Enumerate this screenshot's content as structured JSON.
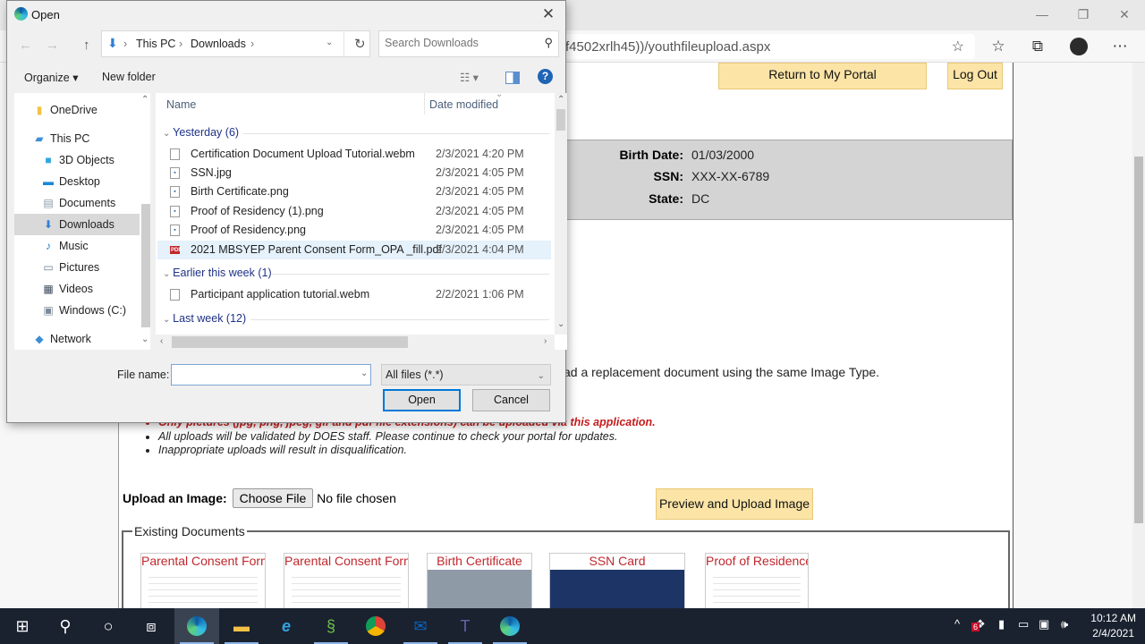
{
  "browser": {
    "address_text": "f4502xrlh45))/youthfileupload.aspx",
    "window_controls": {
      "minimize": "—",
      "restore": "❐",
      "close": "✕"
    },
    "toolbar_icons": [
      "add-favorite-icon",
      "favorites-icon",
      "collections-icon",
      "profile-avatar",
      "more-icon"
    ]
  },
  "page": {
    "return_portal_label": "Return to My Portal",
    "logout_label": "Log Out",
    "info": [
      {
        "label": "Birth Date:",
        "value": "01/03/2000"
      },
      {
        "label": "SSN:",
        "value": "XXX-XX-6789"
      },
      {
        "label": "State:",
        "value": "DC"
      }
    ],
    "replacement_text": "ad a replacement document using the same Image Type.",
    "bullets": [
      "Only pictures (jpg, png, jpeg, gif and pdf file extensions) can be uploaded via this application.",
      "All uploads will be validated by DOES staff. Please continue to check your portal for updates.",
      "Inappropriate uploads will result in disqualification."
    ],
    "upload_label": "Upload an Image:",
    "choose_file_label": "Choose File",
    "no_file_text": "No file chosen",
    "preview_upload_label": "Preview and Upload Image",
    "existing_documents_label": "Existing Documents",
    "documents": [
      {
        "title": "Parental Consent Form"
      },
      {
        "title": "Parental Consent Form"
      },
      {
        "title": "Birth Certificate"
      },
      {
        "title": "SSN Card"
      },
      {
        "title": "Proof of Residence"
      }
    ]
  },
  "dialog": {
    "title": "Open",
    "breadcrumb": [
      "This PC",
      "Downloads"
    ],
    "search_placeholder": "Search Downloads",
    "organize_label": "Organize ▾",
    "new_folder_label": "New folder",
    "nav_items": [
      {
        "label": "OneDrive",
        "icon": "folder-icon"
      },
      {
        "label": "This PC",
        "icon": "computer-icon"
      },
      {
        "label": "3D Objects",
        "icon": "cube-icon"
      },
      {
        "label": "Desktop",
        "icon": "desktop-icon"
      },
      {
        "label": "Documents",
        "icon": "document-icon"
      },
      {
        "label": "Downloads",
        "icon": "download-icon",
        "selected": true
      },
      {
        "label": "Music",
        "icon": "music-icon"
      },
      {
        "label": "Pictures",
        "icon": "pictures-icon"
      },
      {
        "label": "Videos",
        "icon": "videos-icon"
      },
      {
        "label": "Windows (C:)",
        "icon": "drive-icon"
      },
      {
        "label": "Network",
        "icon": "network-icon"
      }
    ],
    "columns": {
      "name": "Name",
      "date": "Date modified"
    },
    "groups": [
      {
        "label": "Yesterday (6)",
        "files": [
          {
            "name": "Certification Document Upload Tutorial.webm",
            "date": "2/3/2021 4:20 PM",
            "type": "file"
          },
          {
            "name": "SSN.jpg",
            "date": "2/3/2021 4:05 PM",
            "type": "image"
          },
          {
            "name": "Birth Certificate.png",
            "date": "2/3/2021 4:05 PM",
            "type": "image"
          },
          {
            "name": "Proof of Residency (1).png",
            "date": "2/3/2021 4:05 PM",
            "type": "image"
          },
          {
            "name": "Proof of Residency.png",
            "date": "2/3/2021 4:05 PM",
            "type": "image"
          },
          {
            "name": "2021 MBSYEP Parent Consent Form_OPA _fill.pdf",
            "date": "2/3/2021 4:04 PM",
            "type": "pdf"
          }
        ]
      },
      {
        "label": "Earlier this week (1)",
        "files": [
          {
            "name": "Participant application tutorial.webm",
            "date": "2/2/2021 1:06 PM",
            "type": "file"
          }
        ]
      },
      {
        "label": "Last week (12)",
        "files": []
      }
    ],
    "file_name_label": "File name:",
    "file_name_value": "",
    "file_type_value": "All files (*.*)",
    "open_label": "Open",
    "cancel_label": "Cancel"
  },
  "taskbar": {
    "apps": [
      "windows-start-icon",
      "search-icon",
      "cortana-icon",
      "task-view-icon",
      "edge-icon",
      "file-explorer-icon",
      "internet-explorer-icon",
      "app-icon",
      "chrome-icon",
      "outlook-icon",
      "teams-icon",
      "edge-icon"
    ],
    "tray_badge": "6",
    "time": "10:12 AM",
    "date": "2/4/2021"
  }
}
